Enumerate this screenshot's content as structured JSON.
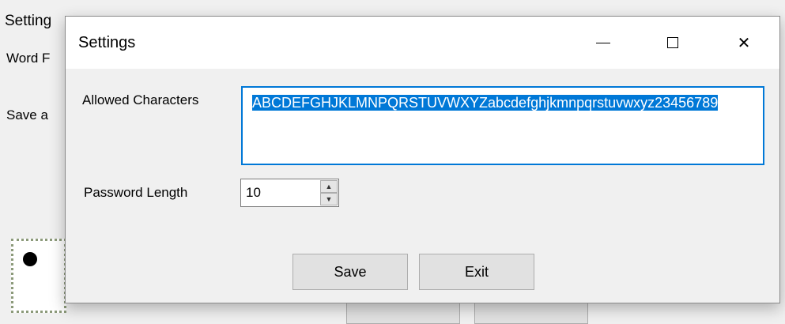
{
  "background_window": {
    "title": "Setting",
    "word_label": "Word F",
    "save_label": "Save a"
  },
  "dialog": {
    "title": "Settings",
    "controls": {
      "minimize_icon": "minimize-icon",
      "maximize_icon": "maximize-icon",
      "close_icon": "close-icon",
      "close_glyph": "✕"
    },
    "allowed_characters": {
      "label": "Allowed Characters",
      "value": "ABCDEFGHJKLMNPQRSTUVWXYZabcdefghjkmnpqrstuvwxyz23456789",
      "selected": true
    },
    "password_length": {
      "label": "Password Length",
      "value": "10"
    },
    "buttons": {
      "save": "Save",
      "exit": "Exit"
    }
  },
  "colors": {
    "selection": "#0078d7",
    "dialog_bg": "#f0f0f0",
    "titlebar_bg": "#ffffff"
  }
}
